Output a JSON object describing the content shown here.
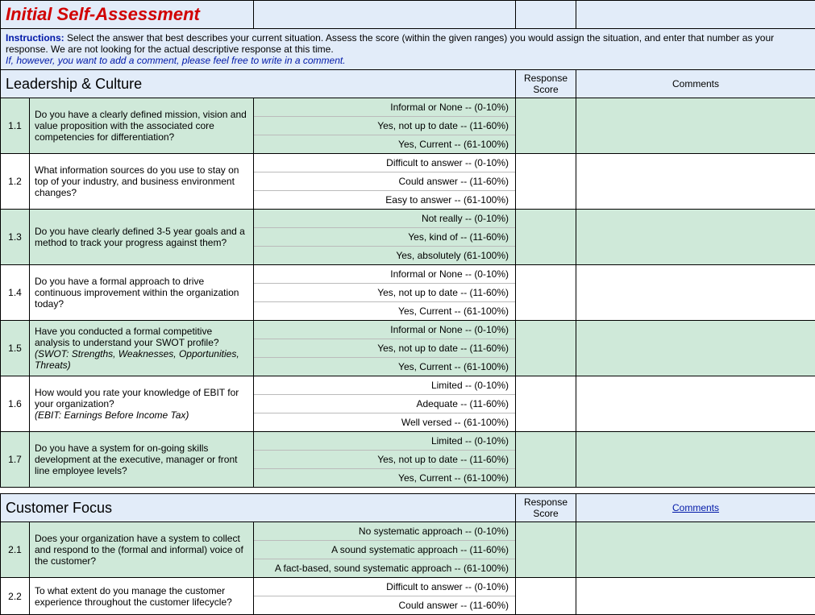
{
  "title": "Initial Self-Assessment",
  "instructions": {
    "label": "Instructions:",
    "text": " Select the answer that best describes your current situation.  Assess the score (within the given ranges) you would assign the situation, and enter that number as your response.  We are not looking for the actual descriptive response at this time.",
    "comment_note": "If, however, you want to add a comment, please feel free to write in a comment."
  },
  "headers": {
    "response": "Response Score",
    "comments": "Comments"
  },
  "sections": [
    {
      "name": "Leadership & Culture",
      "comments_link": false,
      "questions": [
        {
          "num": "1.1",
          "shade": "green",
          "text": "Do you have a clearly defined mission, vision and value proposition with the associated core competencies for differentiation?",
          "note": "",
          "opts": [
            "Informal or None -- (0-10%)",
            "Yes, not up to date -- (11-60%)",
            "Yes, Current -- (61-100%)"
          ]
        },
        {
          "num": "1.2",
          "shade": "white",
          "text": "What information sources do you use to stay on top of your industry, and business environment changes?",
          "note": "",
          "opts": [
            "Difficult to answer -- (0-10%)",
            "Could answer -- (11-60%)",
            "Easy to answer -- (61-100%)"
          ]
        },
        {
          "num": "1.3",
          "shade": "green",
          "text": "Do you have clearly defined 3-5 year goals and a method to track your progress against them?",
          "note": "",
          "opts": [
            "Not really -- (0-10%)",
            "Yes, kind of -- (11-60%)",
            "Yes, absolutely (61-100%)"
          ]
        },
        {
          "num": "1.4",
          "shade": "white",
          "text": "Do you have a formal approach to drive continuous improvement within the organization today?",
          "note": "",
          "opts": [
            "Informal or None -- (0-10%)",
            "Yes, not up to date -- (11-60%)",
            "Yes, Current -- (61-100%)"
          ]
        },
        {
          "num": "1.5",
          "shade": "green",
          "text": "Have you conducted a formal competitive analysis to understand your SWOT profile?",
          "note": "(SWOT: Strengths, Weaknesses, Opportunities, Threats)",
          "opts": [
            "Informal or None -- (0-10%)",
            "Yes, not up to date -- (11-60%)",
            "Yes, Current -- (61-100%)"
          ]
        },
        {
          "num": "1.6",
          "shade": "white",
          "text": "How would you rate  your knowledge of EBIT for your organization?",
          "note": "(EBIT: Earnings Before Income Tax)",
          "opts": [
            "Limited -- (0-10%)",
            "Adequate -- (11-60%)",
            "Well versed -- (61-100%)"
          ]
        },
        {
          "num": "1.7",
          "shade": "green",
          "text": "Do you have a system for on-going skills development at the executive, manager or front line employee levels?",
          "note": "",
          "opts": [
            "Limited -- (0-10%)",
            "Yes, not up to date -- (11-60%)",
            "Yes, Current -- (61-100%)"
          ]
        }
      ]
    },
    {
      "name": "Customer Focus",
      "comments_link": true,
      "questions": [
        {
          "num": "2.1",
          "shade": "green",
          "text": "Does your organization have a system to collect and respond to the (formal and informal) voice of the customer?",
          "note": "",
          "opts": [
            "No systematic approach -- (0-10%)",
            "A sound systematic approach -- (11-60%)",
            "A fact-based, sound systematic approach -- (61-100%)"
          ]
        },
        {
          "num": "2.2",
          "shade": "white",
          "text": "To what extent do you manage the customer experience throughout the customer lifecycle?",
          "note": "",
          "opts": [
            "Difficult to answer -- (0-10%)",
            "Could answer -- (11-60%)"
          ]
        }
      ]
    }
  ]
}
